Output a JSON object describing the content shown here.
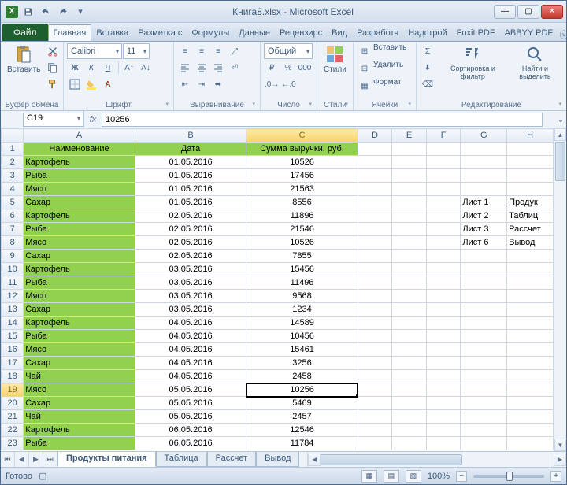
{
  "window": {
    "title": "Книга8.xlsx - Microsoft Excel"
  },
  "qat": {
    "save": "Сохранить",
    "undo": "Отменить",
    "redo": "Вернуть"
  },
  "tabs": {
    "file": "Файл",
    "items": [
      "Главная",
      "Вставка",
      "Разметка с",
      "Формулы",
      "Данные",
      "Рецензирс",
      "Вид",
      "Разработч",
      "Надстрой",
      "Foxit PDF",
      "ABBYY PDF"
    ],
    "active": 0
  },
  "ribbon": {
    "clipboard": {
      "label": "Буфер обмена",
      "paste": "Вставить"
    },
    "font": {
      "label": "Шрифт",
      "name": "Calibri",
      "size": "11"
    },
    "align": {
      "label": "Выравнивание"
    },
    "number": {
      "label": "Число",
      "format": "Общий"
    },
    "styles": {
      "label": "Стили",
      "btn": "Стили"
    },
    "cells": {
      "label": "Ячейки",
      "insert": "Вставить",
      "delete": "Удалить",
      "format": "Формат"
    },
    "editing": {
      "label": "Редактирование",
      "sort": "Сортировка и фильтр",
      "find": "Найти и выделить"
    }
  },
  "namebox": "C19",
  "formula": "10256",
  "cols": [
    "A",
    "B",
    "C",
    "D",
    "E",
    "F",
    "G",
    "H"
  ],
  "header": {
    "a": "Наименование",
    "b": "Дата",
    "c": "Сумма выручки, руб."
  },
  "rows": [
    {
      "n": "Картофель",
      "d": "01.05.2016",
      "v": "10526"
    },
    {
      "n": "Рыба",
      "d": "01.05.2016",
      "v": "17456"
    },
    {
      "n": "Мясо",
      "d": "01.05.2016",
      "v": "21563"
    },
    {
      "n": "Сахар",
      "d": "01.05.2016",
      "v": "8556"
    },
    {
      "n": "Картофель",
      "d": "02.05.2016",
      "v": "11896"
    },
    {
      "n": "Рыба",
      "d": "02.05.2016",
      "v": "21546"
    },
    {
      "n": "Мясо",
      "d": "02.05.2016",
      "v": "10526"
    },
    {
      "n": "Сахар",
      "d": "02.05.2016",
      "v": "7855"
    },
    {
      "n": "Картофель",
      "d": "03.05.2016",
      "v": "15456"
    },
    {
      "n": "Рыба",
      "d": "03.05.2016",
      "v": "11496"
    },
    {
      "n": "Мясо",
      "d": "03.05.2016",
      "v": "9568"
    },
    {
      "n": "Сахар",
      "d": "03.05.2016",
      "v": "1234"
    },
    {
      "n": "Картофель",
      "d": "04.05.2016",
      "v": "14589"
    },
    {
      "n": "Рыба",
      "d": "04.05.2016",
      "v": "10456"
    },
    {
      "n": "Мясо",
      "d": "04.05.2016",
      "v": "15461"
    },
    {
      "n": "Сахар",
      "d": "04.05.2016",
      "v": "3256"
    },
    {
      "n": "Чай",
      "d": "04.05.2016",
      "v": "2458"
    },
    {
      "n": "Мясо",
      "d": "05.05.2016",
      "v": "10256"
    },
    {
      "n": "Сахар",
      "d": "05.05.2016",
      "v": "5469"
    },
    {
      "n": "Чай",
      "d": "05.05.2016",
      "v": "2457"
    },
    {
      "n": "Картофель",
      "d": "06.05.2016",
      "v": "12546"
    },
    {
      "n": "Рыба",
      "d": "06.05.2016",
      "v": "11784"
    }
  ],
  "side": [
    {
      "g": "Лист 1",
      "h": "Продук"
    },
    {
      "g": "Лист 2",
      "h": "Таблиц"
    },
    {
      "g": "Лист 3",
      "h": "Рассчет"
    },
    {
      "g": "Лист 6",
      "h": "Вывод"
    }
  ],
  "active_row": 19,
  "active_col": 3,
  "sheets": {
    "items": [
      "Продукты питания",
      "Таблица",
      "Рассчет",
      "Вывод"
    ],
    "active": 0
  },
  "status": {
    "ready": "Готово",
    "zoom": "100%"
  }
}
